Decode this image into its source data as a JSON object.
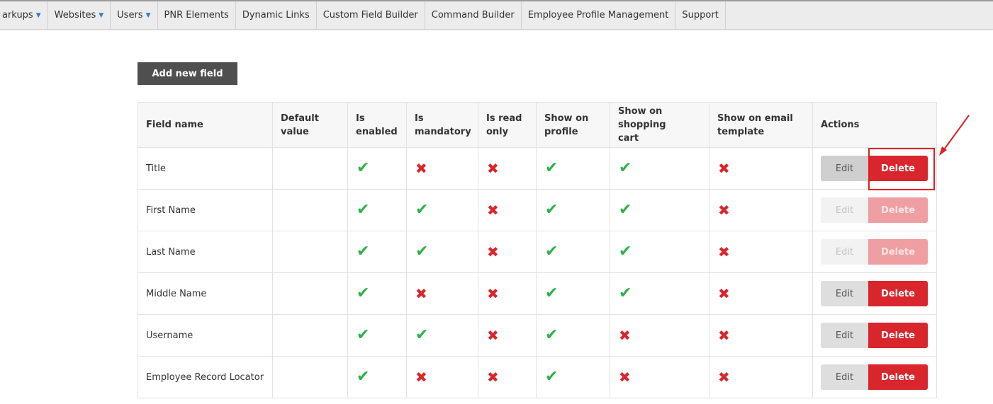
{
  "nav": [
    {
      "label": "arkups",
      "dropdown": true
    },
    {
      "label": "Websites",
      "dropdown": true
    },
    {
      "label": "Users",
      "dropdown": true
    },
    {
      "label": "PNR Elements",
      "dropdown": false
    },
    {
      "label": "Dynamic Links",
      "dropdown": false
    },
    {
      "label": "Custom Field Builder",
      "dropdown": false
    },
    {
      "label": "Command Builder",
      "dropdown": false
    },
    {
      "label": "Employee Profile Management",
      "dropdown": false
    },
    {
      "label": "Support",
      "dropdown": false
    }
  ],
  "add_button_label": "Add new field",
  "columns": [
    {
      "line1": "Field name",
      "line2": ""
    },
    {
      "line1": "Default",
      "line2": "value"
    },
    {
      "line1": "Is",
      "line2": "enabled"
    },
    {
      "line1": "Is",
      "line2": "mandatory"
    },
    {
      "line1": "Is read",
      "line2": "only"
    },
    {
      "line1": "Show on",
      "line2": "profile"
    },
    {
      "line1": "Show on shopping",
      "line2": "cart"
    },
    {
      "line1": "Show on email",
      "line2": "template"
    },
    {
      "line1": "Actions",
      "line2": ""
    }
  ],
  "rows": [
    {
      "name": "Title",
      "default": "",
      "enabled": true,
      "mandatory": false,
      "readonly": false,
      "profile": true,
      "cart": true,
      "email": false,
      "actions_disabled": false
    },
    {
      "name": "First Name",
      "default": "",
      "enabled": true,
      "mandatory": true,
      "readonly": false,
      "profile": true,
      "cart": true,
      "email": false,
      "actions_disabled": true
    },
    {
      "name": "Last Name",
      "default": "",
      "enabled": true,
      "mandatory": true,
      "readonly": false,
      "profile": true,
      "cart": true,
      "email": false,
      "actions_disabled": true
    },
    {
      "name": "Middle Name",
      "default": "",
      "enabled": true,
      "mandatory": false,
      "readonly": false,
      "profile": true,
      "cart": true,
      "email": false,
      "actions_disabled": false
    },
    {
      "name": "Username",
      "default": "",
      "enabled": true,
      "mandatory": true,
      "readonly": false,
      "profile": true,
      "cart": false,
      "email": false,
      "actions_disabled": false
    },
    {
      "name": "Employee Record Locator",
      "default": "",
      "enabled": true,
      "mandatory": false,
      "readonly": false,
      "profile": true,
      "cart": false,
      "email": false,
      "actions_disabled": false
    }
  ],
  "edit_label": "Edit",
  "delete_label": "Delete",
  "icons": {
    "true": "check-icon",
    "false": "cross-icon"
  },
  "colors": {
    "check": "#2db34a",
    "cross": "#d9262c",
    "delete": "#d9262c",
    "annotation": "#e02020"
  }
}
